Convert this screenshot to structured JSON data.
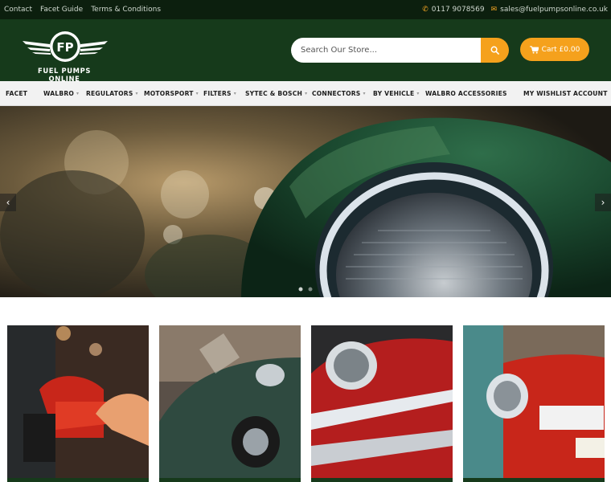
{
  "topbar": {
    "links": [
      "Contact",
      "Facet Guide",
      "Terms & Conditions"
    ],
    "phone": "0117 9078569",
    "email": "sales@fuelpumpsonline.co.uk"
  },
  "header": {
    "logo_monogram": "FP",
    "logo_text": "FUEL PUMPS ONLINE",
    "search_placeholder": "Search Our Store...",
    "cart_label": "Cart £0.00"
  },
  "nav": {
    "items": [
      "FACET",
      "WALBRO",
      "REGULATORS",
      "MOTORSPORT",
      "FILTERS",
      "SYTEC & BOSCH",
      "CONNECTORS",
      "BY VEHICLE",
      "WALBRO ACCESSORIES"
    ],
    "wishlist": "MY WISHLIST",
    "account": "ACCOUNT"
  },
  "colors": {
    "header_green": "#163a1b",
    "topbar_green": "#0c1f0e",
    "accent_orange": "#f5a11c"
  },
  "icons": {
    "phone": "phone-icon",
    "email": "email-icon",
    "search": "search-icon",
    "cart": "cart-icon",
    "prev": "chevron-left-icon",
    "next": "chevron-right-icon"
  }
}
